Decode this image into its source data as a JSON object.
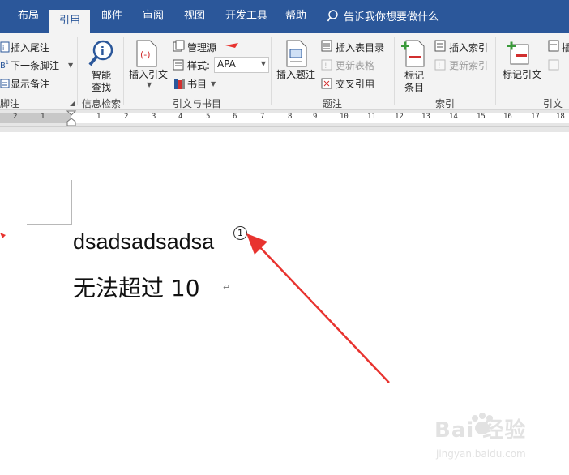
{
  "tabs": [
    {
      "label": "布局"
    },
    {
      "label": "引用",
      "active": true
    },
    {
      "label": "邮件"
    },
    {
      "label": "审阅"
    },
    {
      "label": "视图"
    },
    {
      "label": "开发工具"
    },
    {
      "label": "帮助"
    }
  ],
  "tell_me": "告诉我你想要做什么",
  "ribbon": {
    "footnotes": {
      "insert_endnote": "插入尾注",
      "next_footnote": "下一条脚注",
      "show_notes": "显示备注",
      "group_label": "脚注"
    },
    "research": {
      "smart_lookup_line1": "智能",
      "smart_lookup_line2": "查找",
      "group_label": "信息检索"
    },
    "citations": {
      "insert_citation": "插入引文",
      "manage_sources": "管理源",
      "style_label": "样式:",
      "style_value": "APA",
      "bibliography": "书目",
      "group_label": "引文与书目"
    },
    "captions": {
      "insert_caption": "插入题注",
      "insert_table_of_figures": "插入表目录",
      "update_table": "更新表格",
      "cross_reference": "交叉引用",
      "group_label": "题注"
    },
    "index": {
      "mark_entry_line1": "标记",
      "mark_entry_line2": "条目",
      "insert_index": "插入索引",
      "update_index": "更新索引",
      "group_label": "索引"
    },
    "toa": {
      "mark_citation": "标记引文",
      "insert_toa": "插",
      "group_label": "引文目"
    }
  },
  "ruler_numbers": [
    "2",
    "1",
    "1",
    "2",
    "3",
    "4",
    "5",
    "6",
    "7",
    "8",
    "9",
    "10",
    "11",
    "12",
    "13",
    "14",
    "15",
    "16",
    "17",
    "18"
  ],
  "document": {
    "line1": "dsadsadsadsa",
    "footnote_mark": "1",
    "line2": "无法超过 10",
    "para_mark": "↵"
  },
  "watermark": {
    "brand": "Bai  经验",
    "url": "jingyan.baidu.com"
  },
  "colors": {
    "ribbon_blue": "#2b579a",
    "arrow_red": "#e8332f",
    "ribbon_bg": "#f3f3f3"
  }
}
